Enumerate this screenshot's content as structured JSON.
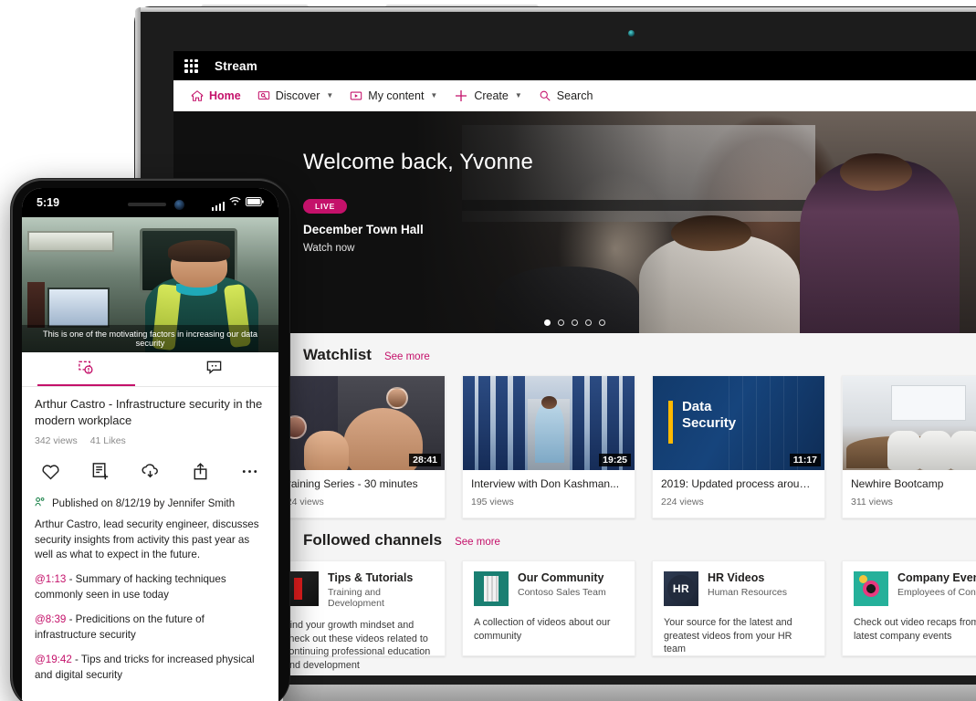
{
  "app": {
    "suite_title": "Stream",
    "waffle_icon": "app-launcher-icon"
  },
  "command_bar": {
    "items": [
      {
        "label": "Home",
        "icon": "home-icon",
        "active": true,
        "has_chevron": false
      },
      {
        "label": "Discover",
        "icon": "discover-icon",
        "active": false,
        "has_chevron": true
      },
      {
        "label": "My content",
        "icon": "video-icon",
        "active": false,
        "has_chevron": true
      },
      {
        "label": "Create",
        "icon": "plus-icon",
        "active": false,
        "has_chevron": true
      },
      {
        "label": "Search",
        "icon": "search-icon",
        "active": false,
        "has_chevron": false
      }
    ]
  },
  "hero": {
    "welcome": "Welcome back, Yvonne",
    "live_badge": "LIVE",
    "event_title": "December Town Hall",
    "watch_label": "Watch now",
    "carousel_total": 5,
    "carousel_active": 1
  },
  "watchlist": {
    "title": "Watchlist",
    "see_more": "See more",
    "videos": [
      {
        "title": "Training Series - 30 minutes",
        "views": "124 views",
        "duration": "28:41",
        "thumb": "teams-meeting-thumb"
      },
      {
        "title": "Interview with Don Kashman...",
        "views": "195 views",
        "duration": "19:25",
        "thumb": "datacenter-thumb"
      },
      {
        "title": "2019: Updated process around...",
        "views": "224 views",
        "duration": "11:17",
        "thumb": "data-security-title-card"
      },
      {
        "title": "Newhire Bootcamp",
        "views": "311 views",
        "duration": "",
        "thumb": "boardroom-thumb"
      }
    ]
  },
  "followed_channels": {
    "title": "Followed channels",
    "see_more": "See more",
    "channels": [
      {
        "name": "Tips & Tutorials",
        "owner": "Training and Development",
        "desc": "Find your growth mindset and check out these videos related to continuing professional education and development",
        "thumb": "tips-tutorials-thumb"
      },
      {
        "name": "Our Community",
        "owner": "Contoso Sales Team",
        "desc": "A collection of videos about our community",
        "thumb": "our-community-thumb"
      },
      {
        "name": "HR Videos",
        "owner": "Human Resources",
        "desc": "Your source for the latest and greatest videos from your HR team",
        "thumb": "hr-videos-thumb",
        "thumb_text": "HR"
      },
      {
        "name": "Company Events",
        "owner": "Employees of Contoso",
        "desc": "Check out video recaps from the latest company events",
        "thumb": "company-events-thumb"
      }
    ]
  },
  "phone": {
    "status": {
      "time": "5:19",
      "signal_icon": "cellular-signal-icon",
      "wifi_icon": "wifi-icon",
      "battery_icon": "battery-icon"
    },
    "video": {
      "caption": "This is one of the motivating factors in increasing our data security"
    },
    "tabs": [
      {
        "icon": "video-details-icon",
        "active": true
      },
      {
        "icon": "comments-icon",
        "active": false
      }
    ],
    "video_title": "Arthur Castro - Infrastructure security in the modern workplace",
    "views": "342 views",
    "likes": "41 Likes",
    "actions": [
      {
        "icon": "heart-icon"
      },
      {
        "icon": "add-to-watchlist-icon"
      },
      {
        "icon": "download-icon"
      },
      {
        "icon": "share-icon"
      },
      {
        "icon": "more-ellipsis-icon"
      }
    ],
    "published": "Published on 8/12/19 by Jennifer Smith",
    "published_icon": "people-icon",
    "description": "Arthur Castro, lead security engineer, discusses security insights from activity this past year as well as what to expect in the future.",
    "timestamps": [
      {
        "time": "@1:13",
        "text": " - Summary of hacking techniques commonly seen in use today"
      },
      {
        "time": "@8:39",
        "text": " - Predicitions on the future of infrastructure security"
      },
      {
        "time": "@19:42",
        "text": " - Tips and tricks for increased physical and digital security"
      }
    ]
  },
  "colors": {
    "accent": "#C4116A",
    "suite_bar": "#000000",
    "page_bg": "#F5F5F5"
  }
}
